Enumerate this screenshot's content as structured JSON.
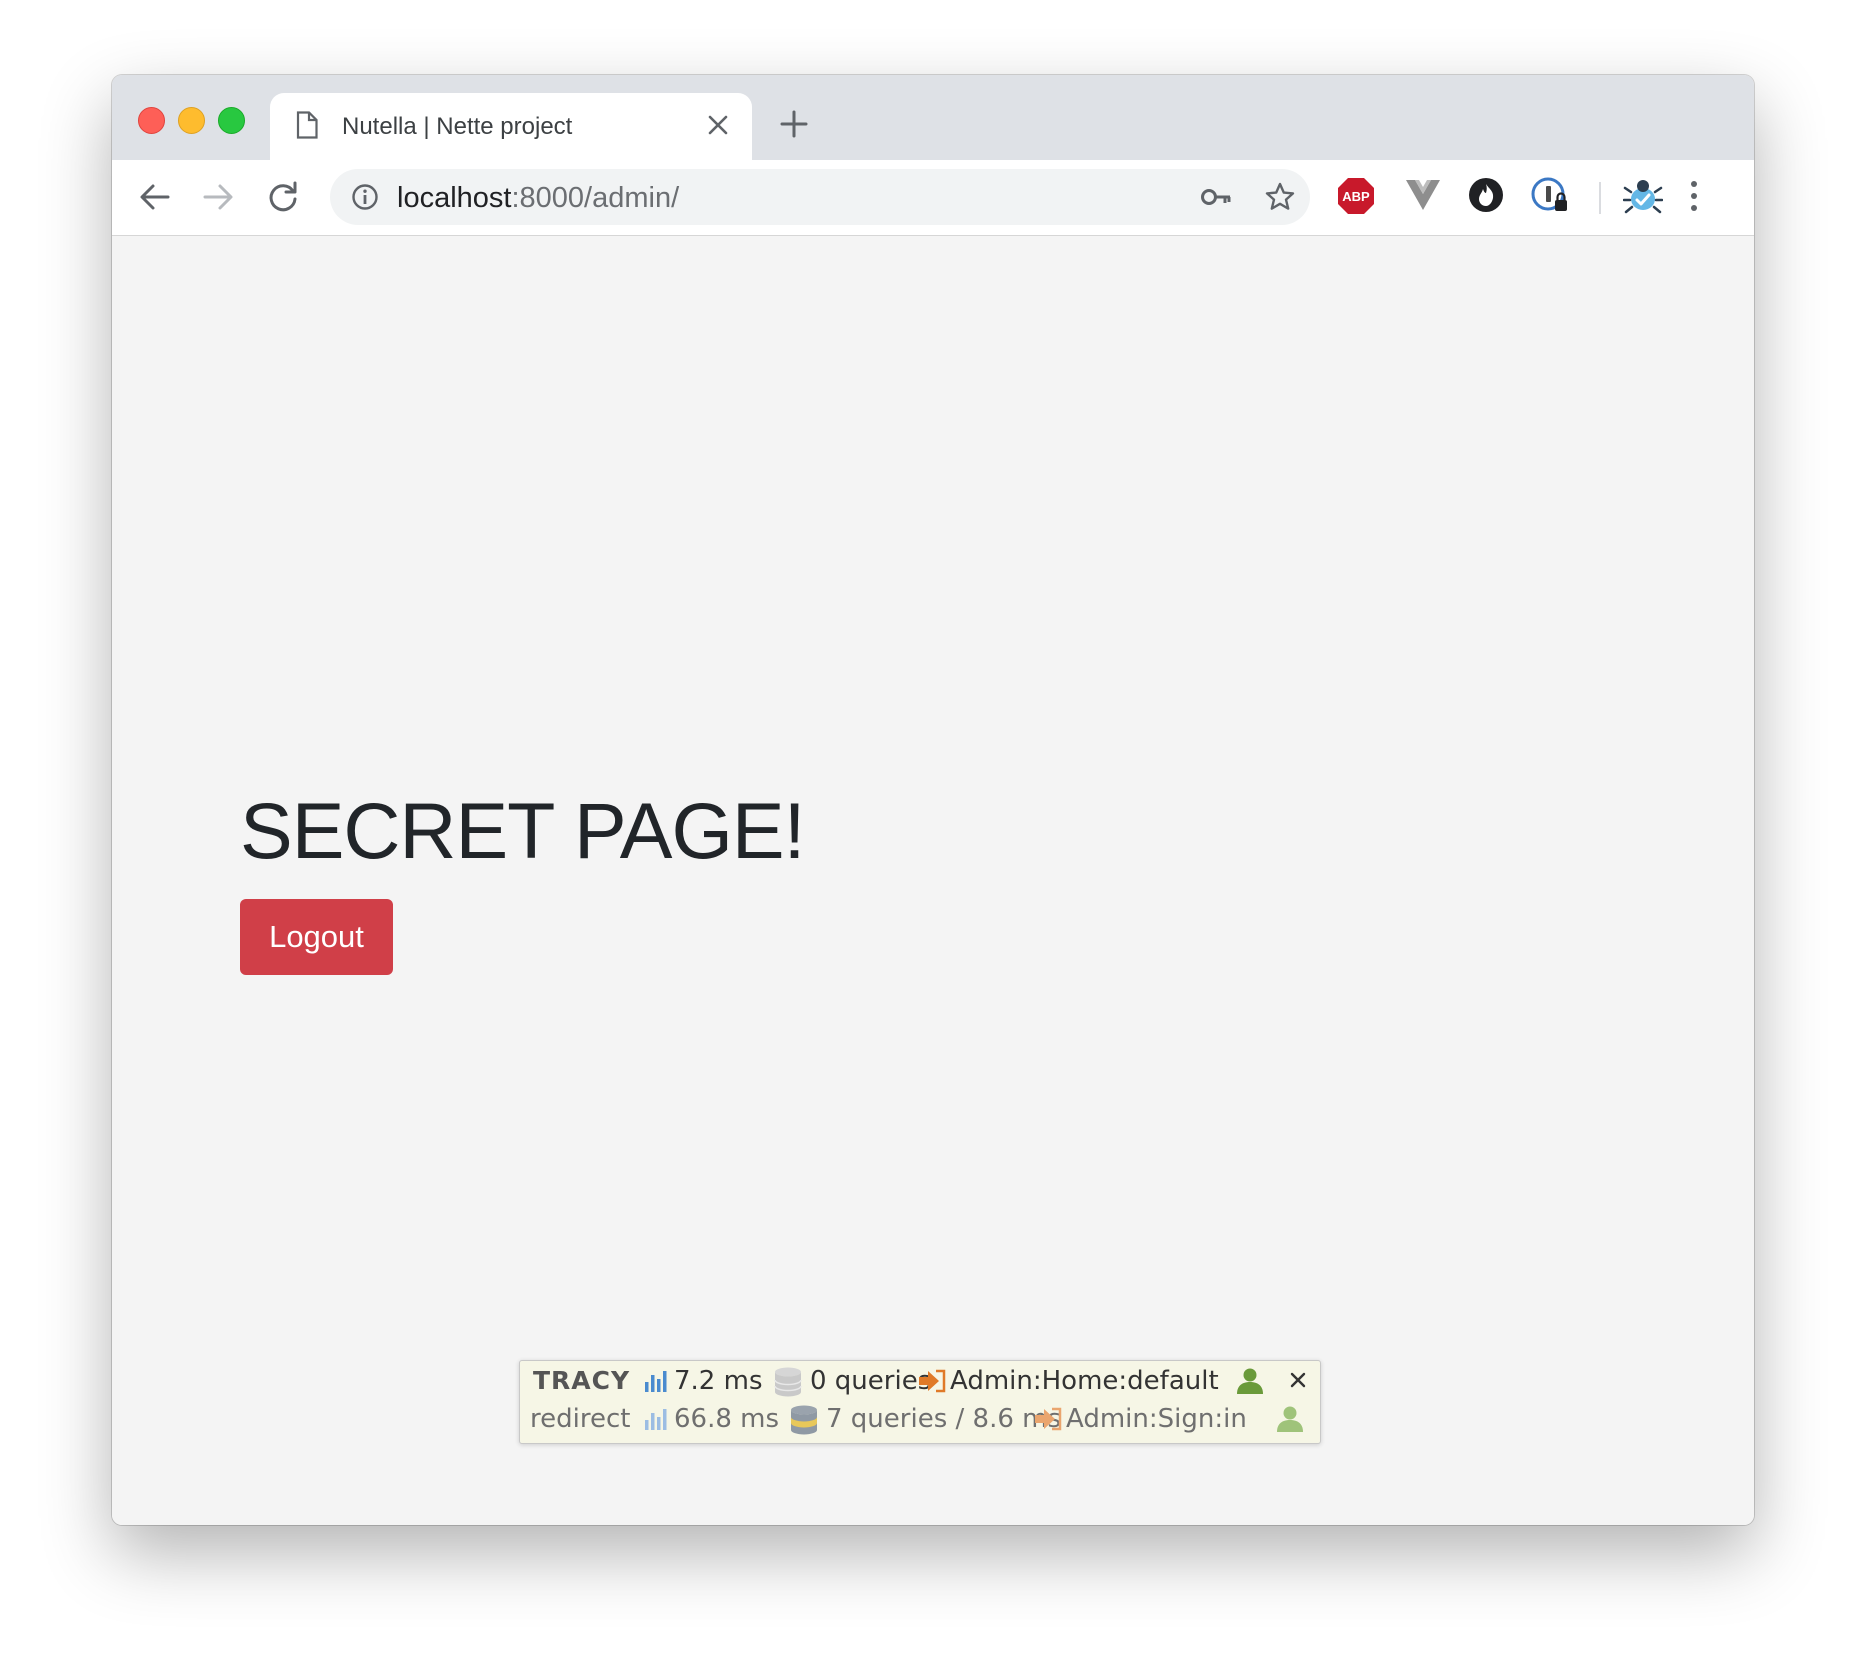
{
  "browser": {
    "tab": {
      "title": "Nutella | Nette project"
    },
    "address": {
      "host": "localhost",
      "rest": ":8000/admin/"
    },
    "extensions": {
      "adblock_label": "ABP"
    }
  },
  "page": {
    "heading": "SECRET PAGE!",
    "logout_label": "Logout",
    "colors": {
      "logout_bg": "#d03f48",
      "text": "#212529",
      "background": "#f4f4f4"
    }
  },
  "tracy": {
    "logo": "TRACY",
    "current": {
      "time": "7.2 ms",
      "queries": "0 queries",
      "route": "Admin:Home:default"
    },
    "redirect": {
      "label": "redirect",
      "time": "66.8 ms",
      "queries": "7 queries / 8.6 ms",
      "route": "Admin:Sign:in"
    }
  },
  "icons": [
    "close-window",
    "minimize-window",
    "maximize-window",
    "page-icon",
    "close-icon",
    "plus-icon",
    "back-arrow-icon",
    "forward-arrow-icon",
    "reload-icon",
    "info-icon",
    "key-icon",
    "star-icon",
    "adblock-icon",
    "vue-icon",
    "flame-icon",
    "onepassword-icon",
    "bug-icon",
    "menu-icon",
    "chart-icon",
    "database-icon",
    "route-icon",
    "user-icon"
  ]
}
